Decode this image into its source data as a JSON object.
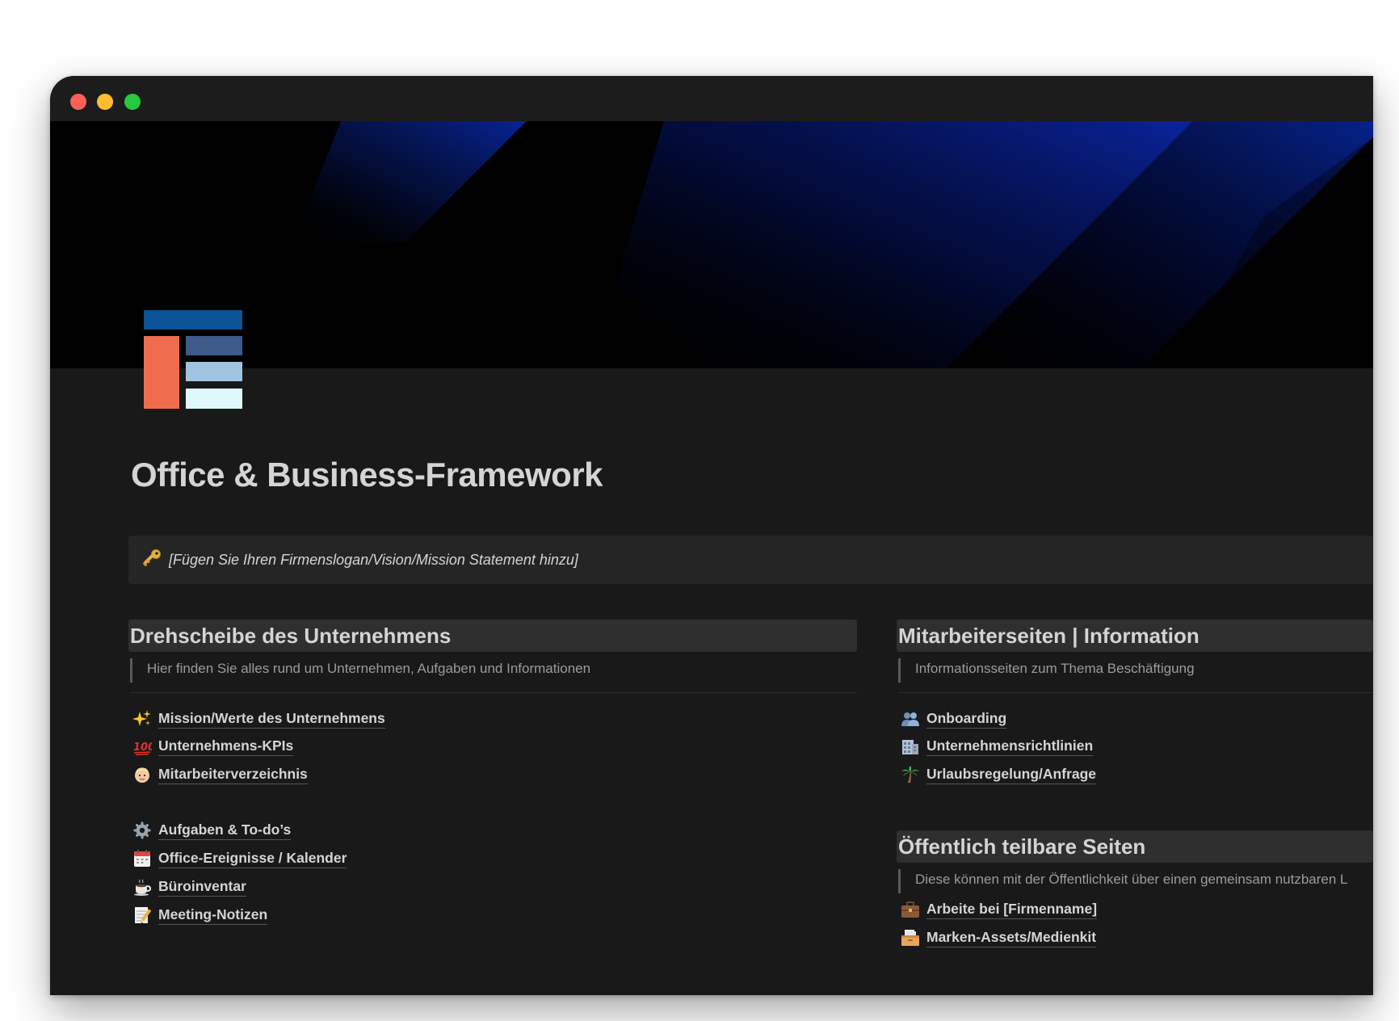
{
  "page": {
    "title": "Office & Business-Framework",
    "icon": "framework-layout-icon",
    "cover": "dark-blue-diagonal-gradient"
  },
  "callout": {
    "icon": "key-icon",
    "text": "[Fügen Sie Ihren Firmenslogan/Vision/Mission Statement hinzu]"
  },
  "left": {
    "heading": "Drehscheibe des Unternehmens",
    "subtitle": "Hier finden Sie alles rund um Unternehmen, Aufgaben und Informationen",
    "group1": [
      {
        "icon": "sparkles-icon",
        "label": "Mission/Werte des Unternehmens"
      },
      {
        "icon": "hundred-points-icon",
        "label": "Unternehmens-KPIs"
      },
      {
        "icon": "person-face-icon",
        "label": "Mitarbeiterverzeichnis"
      }
    ],
    "group2": [
      {
        "icon": "gear-icon",
        "label": "Aufgaben & To-do’s"
      },
      {
        "icon": "calendar-icon",
        "label": "Office-Ereignisse / Kalender"
      },
      {
        "icon": "coffee-cup-icon",
        "label": "Büroinventar"
      },
      {
        "icon": "memo-icon",
        "label": "Meeting-Notizen"
      }
    ]
  },
  "right": {
    "heading": "Mitarbeiterseiten | Information",
    "subtitle": "Informationsseiten zum Thema Beschäftigung",
    "items": [
      {
        "icon": "people-icon",
        "label": "Onboarding"
      },
      {
        "icon": "office-building-icon",
        "label": "Unternehmensrichtlinien"
      },
      {
        "icon": "palm-tree-icon",
        "label": "Urlaubsregelung/Anfrage"
      }
    ],
    "public_heading": "Öffentlich teilbare Seiten",
    "public_subtitle": "Diese können mit der Öffentlichkeit über einen gemeinsam nutzbaren L",
    "public_items": [
      {
        "icon": "briefcase-icon",
        "label": "Arbeite bei [Firmenname]"
      },
      {
        "icon": "card-file-box-icon",
        "label": "Marken-Assets/Medienkit"
      }
    ]
  },
  "colors": {
    "background": "#191919",
    "text": "#d4d4d4",
    "muted": "#9b9b9b",
    "callout_bg": "#252525",
    "heading_bg": "#2f2f2f",
    "accent_blue": "#0a2a9a"
  }
}
